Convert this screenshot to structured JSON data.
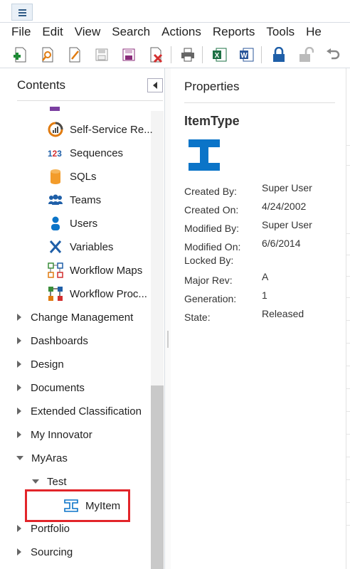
{
  "menubar": {
    "items": [
      "File",
      "Edit",
      "View",
      "Search",
      "Actions",
      "Reports",
      "Tools",
      "He"
    ]
  },
  "toolbar": {
    "buttons": [
      "new-item",
      "search",
      "edit",
      "save",
      "save-and-close",
      "delete",
      "print",
      "excel",
      "word",
      "lock",
      "unlock",
      "undo"
    ]
  },
  "contents": {
    "title": "Contents",
    "items": [
      {
        "label": "Self-Service Re...",
        "icon": "self-service-reports-icon"
      },
      {
        "label": "Sequences",
        "icon": "sequences-icon"
      },
      {
        "label": "SQLs",
        "icon": "sqls-icon"
      },
      {
        "label": "Teams",
        "icon": "teams-icon"
      },
      {
        "label": "Users",
        "icon": "users-icon"
      },
      {
        "label": "Variables",
        "icon": "variables-icon"
      },
      {
        "label": "Workflow Maps",
        "icon": "workflow-maps-icon"
      },
      {
        "label": "Workflow Proc...",
        "icon": "workflow-processes-icon"
      }
    ],
    "categories": [
      {
        "label": "Change Management",
        "expanded": false
      },
      {
        "label": "Dashboards",
        "expanded": false
      },
      {
        "label": "Design",
        "expanded": false
      },
      {
        "label": "Documents",
        "expanded": false
      },
      {
        "label": "Extended Classification",
        "expanded": false
      },
      {
        "label": "My Innovator",
        "expanded": false
      },
      {
        "label": "MyAras",
        "expanded": true
      },
      {
        "label": "Test",
        "expanded": true
      },
      {
        "label": "MyItem",
        "icon": "itemtype-icon"
      },
      {
        "label": "Portfolio",
        "expanded": false
      },
      {
        "label": "Sourcing",
        "expanded": false
      }
    ]
  },
  "properties": {
    "title": "Properties",
    "item_type": "ItemType",
    "fields": [
      {
        "label": "Created By:",
        "value": "Super User"
      },
      {
        "label": "Created On:",
        "value": "4/24/2002"
      },
      {
        "label": "Modified By:",
        "value": "Super User"
      },
      {
        "label": "Modified On:",
        "value": "6/6/2014"
      },
      {
        "label": "Locked By:",
        "value": ""
      },
      {
        "label": "Major Rev:",
        "value": "A"
      },
      {
        "label": "Generation:",
        "value": "1"
      },
      {
        "label": "State:",
        "value": "Released"
      }
    ]
  },
  "colors": {
    "accent": "#0b74c8",
    "highlight": "#e2252a"
  }
}
